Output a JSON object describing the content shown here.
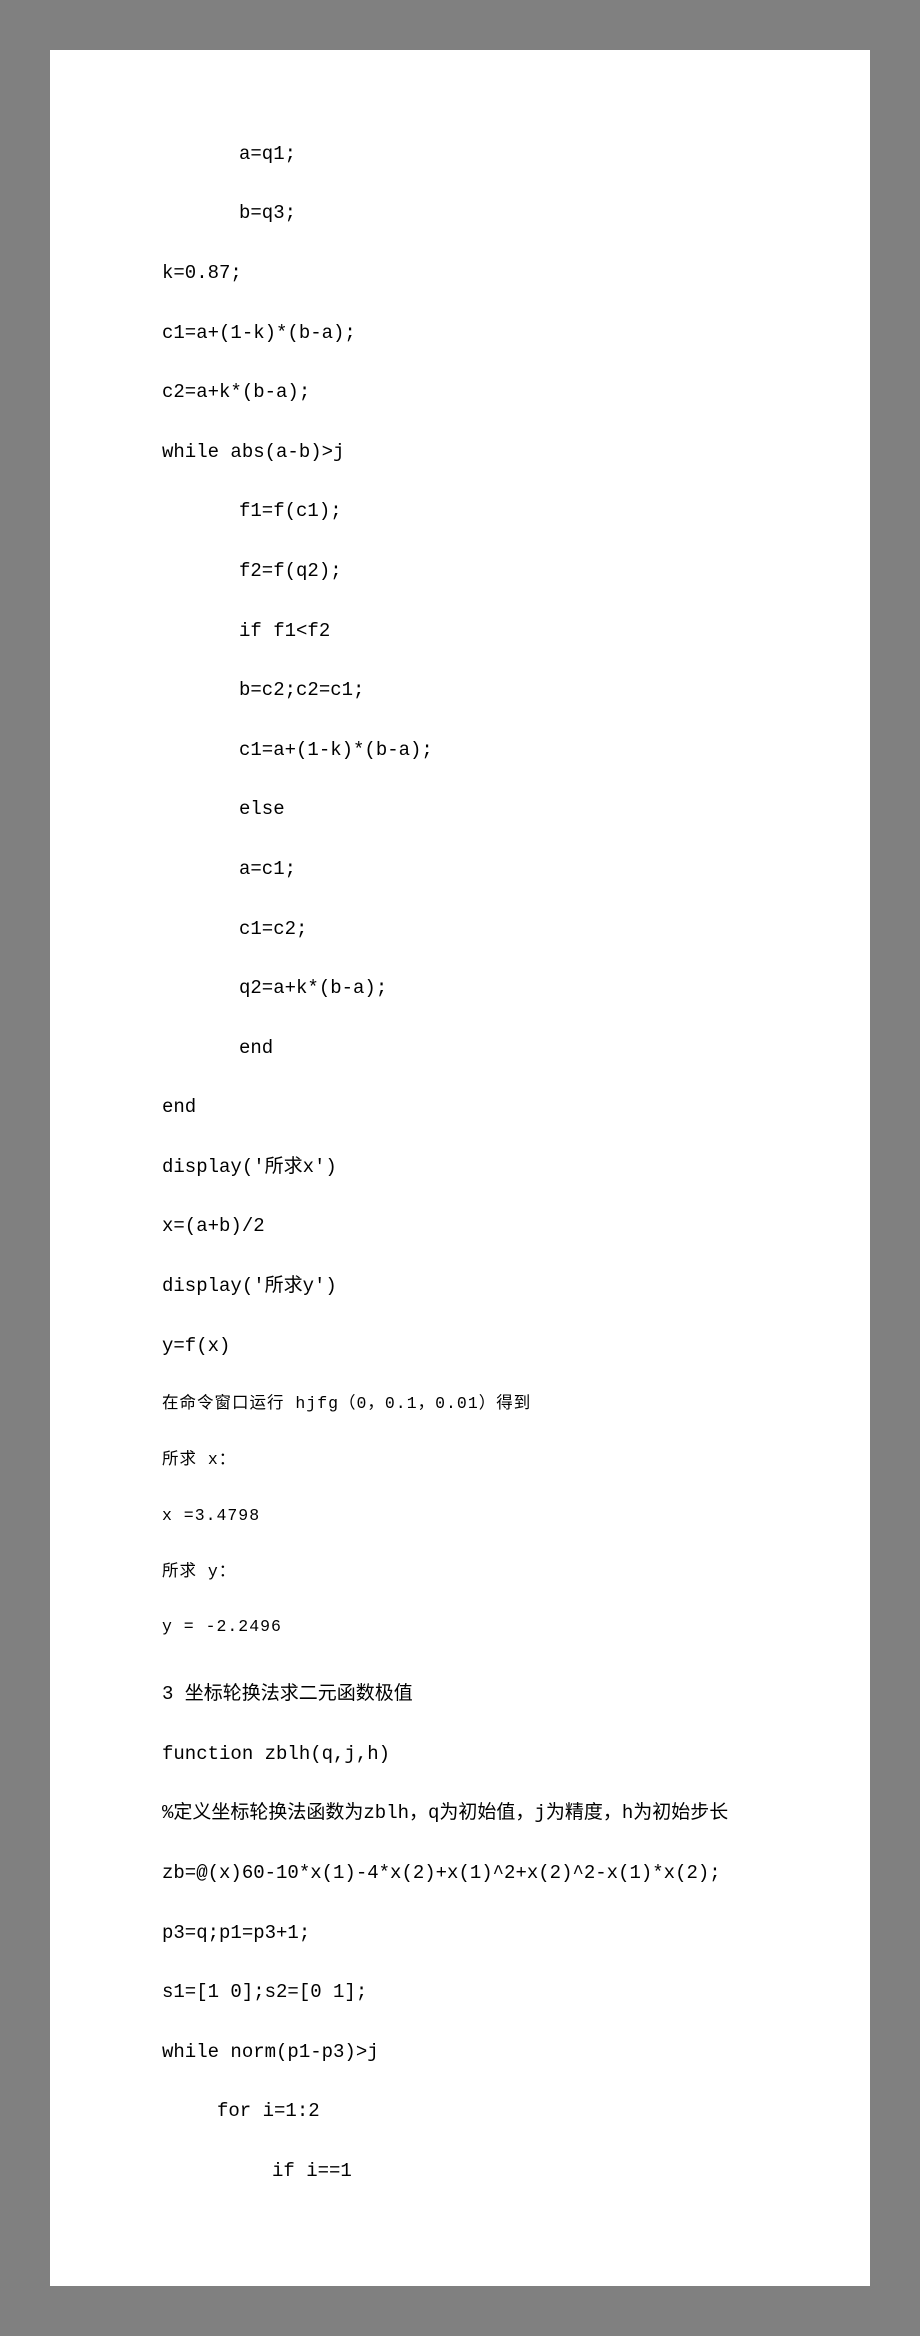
{
  "code_block_1": {
    "l01": "a=q1;",
    "l02": "b=q3;",
    "l03": "k=0.87;",
    "l04": "c1=a+(1-k)*(b-a);",
    "l05": "c2=a+k*(b-a);",
    "l06": "while abs(a-b)>j",
    "l07": "f1=f(c1);",
    "l08": "f2=f(q2);",
    "l09": "if f1<f2",
    "l10": "b=c2;c2=c1;",
    "l11": "c1=a+(1-k)*(b-a);",
    "l12": "else",
    "l13": "a=c1;",
    "l14": "c1=c2;",
    "l15": "q2=a+k*(b-a);",
    "l16": "end",
    "l17": "end",
    "l18": "display('所求x')",
    "l19": "x=(a+b)/2",
    "l20": "display('所求y')",
    "l21": "y=f(x)"
  },
  "output_block": {
    "o1": "在命令窗口运行 hjfg（0，0.1，0.01）得到",
    "o2": "所求 x：",
    "o3": "x =3.4798",
    "o4": "所求 y：",
    "o5": "y = -2.2496"
  },
  "section_3": {
    "heading": "3 坐标轮换法求二元函数极值",
    "l01": "function zblh(q,j,h)",
    "l02": "%定义坐标轮换法函数为zblh，q为初始值，j为精度，h为初始步长",
    "l03": "zb=@(x)60-10*x(1)-4*x(2)+x(1)^2+x(2)^2-x(1)*x(2);",
    "l04": "p3=q;p1=p3+1;",
    "l05": "s1=[1 0];s2=[0 1];",
    "l06": "while norm(p1-p3)>j",
    "l07": "for i=1:2",
    "l08": "if i==1"
  }
}
